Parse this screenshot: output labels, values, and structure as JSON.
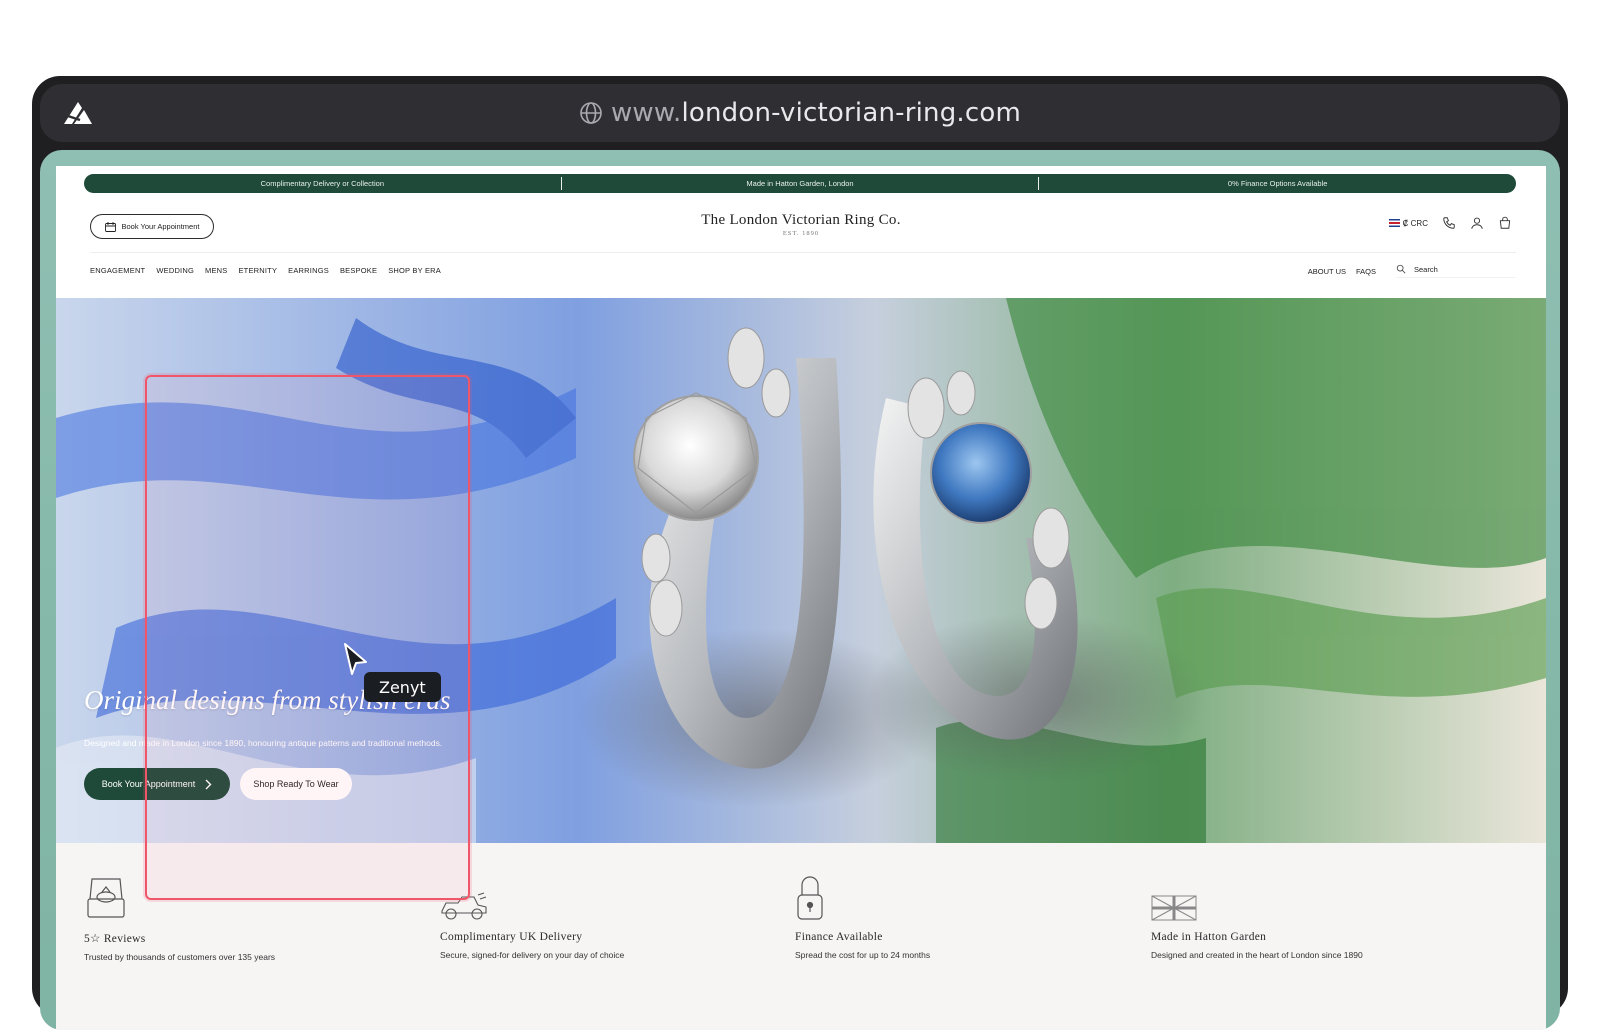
{
  "browser": {
    "url_prefix": "www.",
    "url_domain": "london-victorian-ring.com"
  },
  "announcement_bar": {
    "items": [
      "Complimentary Delivery or Collection",
      "Made in Hatton Garden, London",
      "0% Finance Options Available"
    ]
  },
  "header": {
    "appointment_label": "Book Your Appointment",
    "logo_name": "The London Victorian Ring Co.",
    "logo_est": "EST. 1890",
    "currency": "₡ CRC"
  },
  "nav": {
    "items": [
      "ENGAGEMENT",
      "WEDDING",
      "MENS",
      "ETERNITY",
      "EARRINGS",
      "BESPOKE",
      "SHOP BY ERA"
    ],
    "right_items": [
      "ABOUT US",
      "FAQS"
    ],
    "search_placeholder": "Search"
  },
  "hero": {
    "title": "Original designs from stylish eras",
    "subtitle": "Designed and made in London since 1890, honouring antique patterns and traditional methods.",
    "primary_button": "Book Your Appointment",
    "secondary_button": "Shop Ready To Wear"
  },
  "features": [
    {
      "icon": "ring-box-icon",
      "title": "5☆ Reviews",
      "desc": "Trusted by thousands of customers over 135 years"
    },
    {
      "icon": "vintage-car-icon",
      "title": "Complimentary UK Delivery",
      "desc": "Secure, signed-for delivery on your day of choice"
    },
    {
      "icon": "padlock-icon",
      "title": "Finance Available",
      "desc": "Spread the cost for up to 24 months"
    },
    {
      "icon": "union-jack-icon",
      "title": "Made in Hatton Garden",
      "desc": "Designed and created in the heart of London since 1890"
    }
  ],
  "overlay": {
    "cursor_label": "Zenyt"
  },
  "colors": {
    "brand_green": "#1f4a3a",
    "highlight": "#f0566a",
    "frame_teal": "#8fbfb2"
  }
}
